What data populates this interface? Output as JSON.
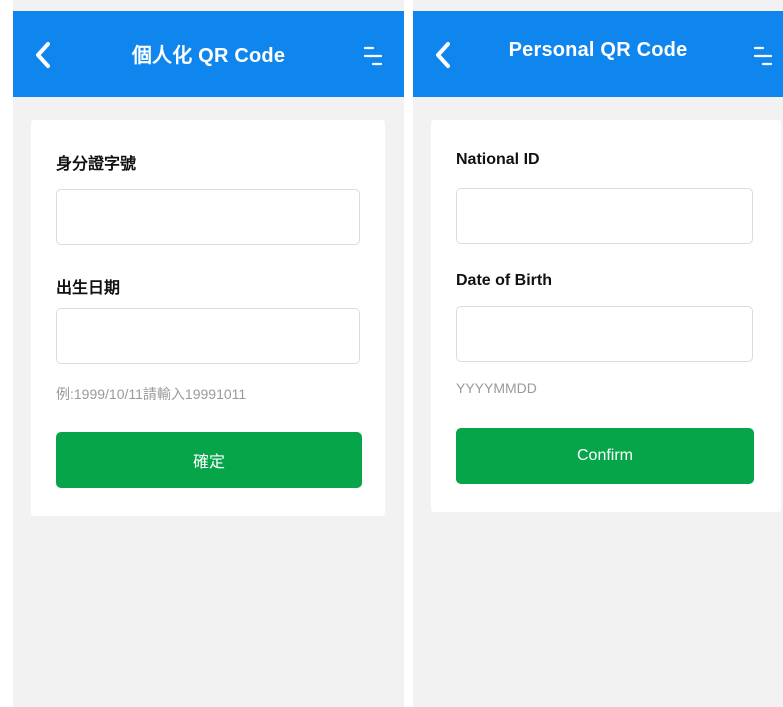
{
  "screens": [
    {
      "title": "個人化 QR Code",
      "id_label": "身分證字號",
      "id_value": "",
      "dob_label": "出生日期",
      "dob_value": "",
      "hint": "例:1999/10/11請輸入19991011",
      "confirm_label": "確定"
    },
    {
      "title": "Personal QR Code",
      "id_label": "National ID",
      "id_value": "",
      "dob_label": "Date of Birth",
      "dob_value": "",
      "hint": "YYYYMMDD",
      "confirm_label": "Confirm"
    }
  ],
  "icons": {
    "back": "chevron-left-icon",
    "menu": "menu-icon"
  },
  "colors": {
    "header": "#0f86ee",
    "background": "#f2f2f2",
    "card": "#ffffff",
    "confirm": "#07a54a",
    "hint": "#9a9a9a"
  }
}
